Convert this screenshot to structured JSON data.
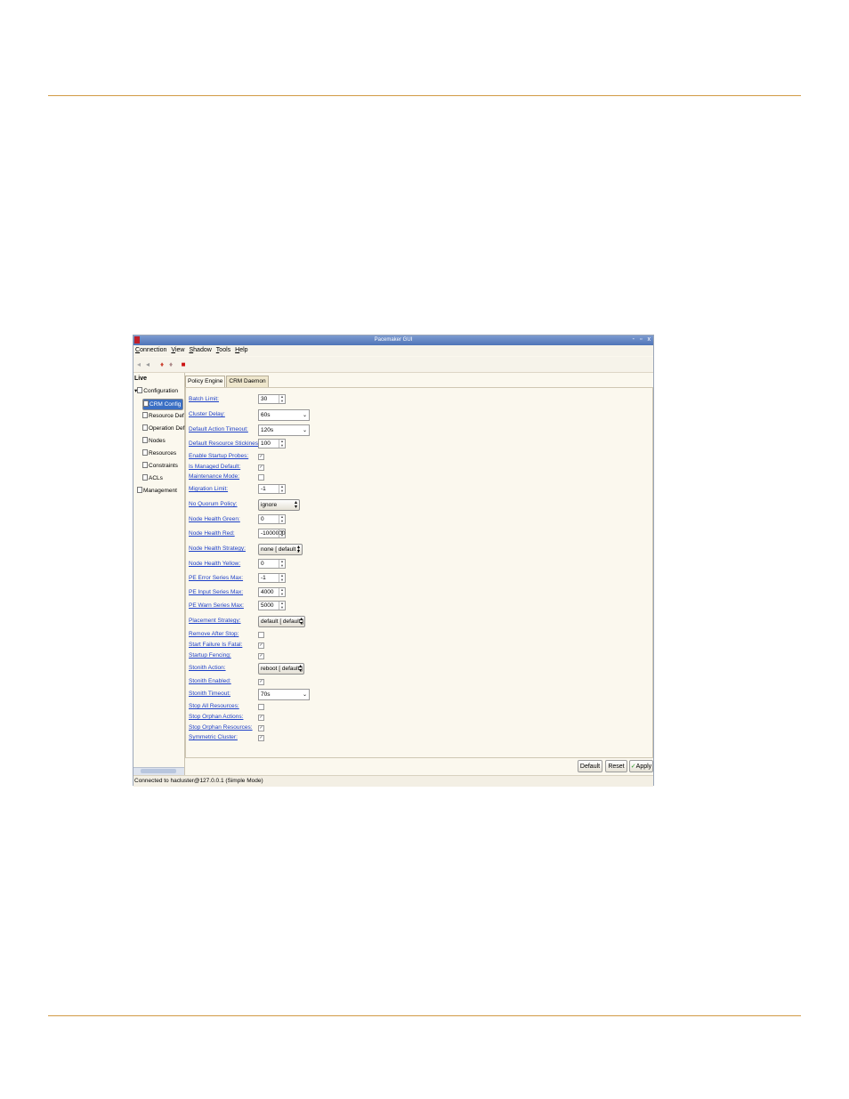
{
  "window": {
    "title": "Pacemaker GUI",
    "buttons": [
      "-",
      "▫",
      "x"
    ]
  },
  "menu": [
    "Connection",
    "View",
    "Shadow",
    "Tools",
    "Help"
  ],
  "toolbar": {
    "icons": [
      "back-icon",
      "forward-icon",
      "connect-icon",
      "disconnect-icon",
      "exit-icon"
    ]
  },
  "tree": {
    "root_label": "Live",
    "items": [
      {
        "label": "Configuration",
        "icon": "folder-icon"
      },
      {
        "label": "CRM Config",
        "icon": "config-icon",
        "selected": true
      },
      {
        "label": "Resource Def",
        "icon": "config-icon"
      },
      {
        "label": "Operation Def",
        "icon": "config-icon"
      },
      {
        "label": "Nodes",
        "icon": "nodes-icon"
      },
      {
        "label": "Resources",
        "icon": "resources-icon"
      },
      {
        "label": "Constraints",
        "icon": "constraints-icon"
      },
      {
        "label": "ACLs",
        "icon": "acls-icon"
      },
      {
        "label": "Management",
        "icon": "management-icon"
      }
    ]
  },
  "tabs": [
    "Policy Engine",
    "CRM Daemon"
  ],
  "fields": [
    {
      "label": "Batch Limit:",
      "type": "spin",
      "value": "30"
    },
    {
      "label": "Cluster Delay:",
      "type": "combo",
      "value": "60s"
    },
    {
      "label": "Default Action Timeout:",
      "type": "combo",
      "value": "120s"
    },
    {
      "label": "Default Resource Stickiness:",
      "type": "spin",
      "value": "100"
    },
    {
      "label": "Enable Startup Probes:",
      "type": "check",
      "value": "✓"
    },
    {
      "label": "Is Managed Default:",
      "type": "check",
      "value": "✓"
    },
    {
      "label": "Maintenance Mode:",
      "type": "check",
      "value": ""
    },
    {
      "label": "Migration Limit:",
      "type": "spin",
      "value": "-1"
    },
    {
      "label": "No Quorum Policy:",
      "type": "select",
      "value": "ignore"
    },
    {
      "label": "Node Health Green:",
      "type": "spin",
      "value": "0"
    },
    {
      "label": "Node Health Red:",
      "type": "spin",
      "value": "-1000000"
    },
    {
      "label": "Node Health Strategy:",
      "type": "select",
      "value": "none [ default ]"
    },
    {
      "label": "Node Health Yellow:",
      "type": "spin",
      "value": "0"
    },
    {
      "label": "PE Error Series Max:",
      "type": "spin",
      "value": "-1"
    },
    {
      "label": "PE Input Series Max:",
      "type": "spin",
      "value": "4000"
    },
    {
      "label": "PE Warn Series Max:",
      "type": "spin",
      "value": "5000"
    },
    {
      "label": "Placement Strategy:",
      "type": "select",
      "value": "default [ default ]"
    },
    {
      "label": "Remove After Stop:",
      "type": "check",
      "value": ""
    },
    {
      "label": "Start Failure Is Fatal:",
      "type": "check",
      "value": "✓"
    },
    {
      "label": "Startup Fencing:",
      "type": "check",
      "value": "✓"
    },
    {
      "label": "Stonith Action:",
      "type": "select",
      "value": "reboot [ default ]"
    },
    {
      "label": "Stonith Enabled:",
      "type": "check",
      "value": "✓"
    },
    {
      "label": "Stonith Timeout:",
      "type": "combo",
      "value": "70s"
    },
    {
      "label": "Stop All Resources:",
      "type": "check",
      "value": ""
    },
    {
      "label": "Stop Orphan Actions:",
      "type": "check",
      "value": "✓"
    },
    {
      "label": "Stop Orphan Resources:",
      "type": "check",
      "value": "✓"
    },
    {
      "label": "Symmetric Cluster:",
      "type": "check",
      "value": "✓"
    }
  ],
  "buttons": {
    "default": "Default",
    "reset": "Reset",
    "apply": "Apply"
  },
  "status": "Connected to hacluster@127.0.0.1 (Simple Mode)",
  "colors": {
    "accent_rule": "#d19a45",
    "link": "#1c3fc8",
    "selection": "#3a6fc4"
  }
}
